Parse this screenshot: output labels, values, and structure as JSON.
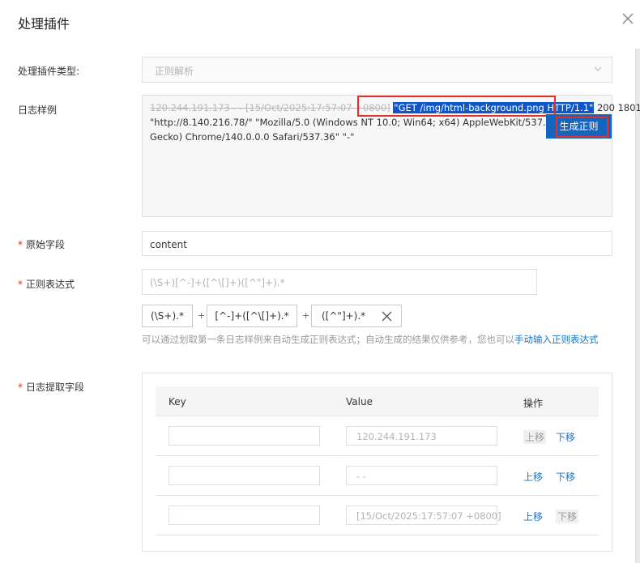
{
  "dialog": {
    "title": "处理插件"
  },
  "form": {
    "plugin_type": {
      "label": "处理插件类型:",
      "value": "正则解析"
    },
    "log_sample": {
      "label": "日志样例",
      "line1_prefix": "120.244.191.173 - - [15/Oct/2025:17:57:07 +0800]",
      "line1_highlight": "\"GET /img/html-background.png HTTP/1.1\"",
      "line1_suffix": "200 1801",
      "line2": "\"http://8.140.216.78/\" \"Mozilla/5.0 (Windows NT 10.0; Win64; x64) AppleWebKit/537.36 (KHTML, like",
      "line3": "Gecko) Chrome/140.0.0.0 Safari/537.36\" \"-\"",
      "generate_button": "生成正则"
    },
    "raw_field": {
      "label": "原始字段",
      "value": "content"
    },
    "regex": {
      "label": "正则表达式",
      "placeholder": "(\\S+)[^-]+([^\\[]+)([^\"]+).*",
      "parts": [
        "(\\S+).*",
        "[^-]+([^\\[]+).*",
        "([^\"]+).*"
      ],
      "plus": "+",
      "hint": "可以通过划取第一条日志样例来自动生成正则表达式；自动生成的结果仅供参考，您也可以",
      "hint_link": "手动输入正则表达式"
    },
    "extract_fields": {
      "label": "日志提取字段",
      "headers": {
        "key": "Key",
        "value": "Value",
        "action": "操作"
      },
      "rows": [
        {
          "key": "",
          "value": "120.244.191.173",
          "up": "上移",
          "down": "下移"
        },
        {
          "key": "",
          "value": "- -",
          "up": "上移",
          "down": "下移"
        },
        {
          "key": "",
          "value": "[15/Oct/2025:17:57:07 +0800]",
          "up": "上移",
          "down": "下移"
        }
      ]
    }
  }
}
